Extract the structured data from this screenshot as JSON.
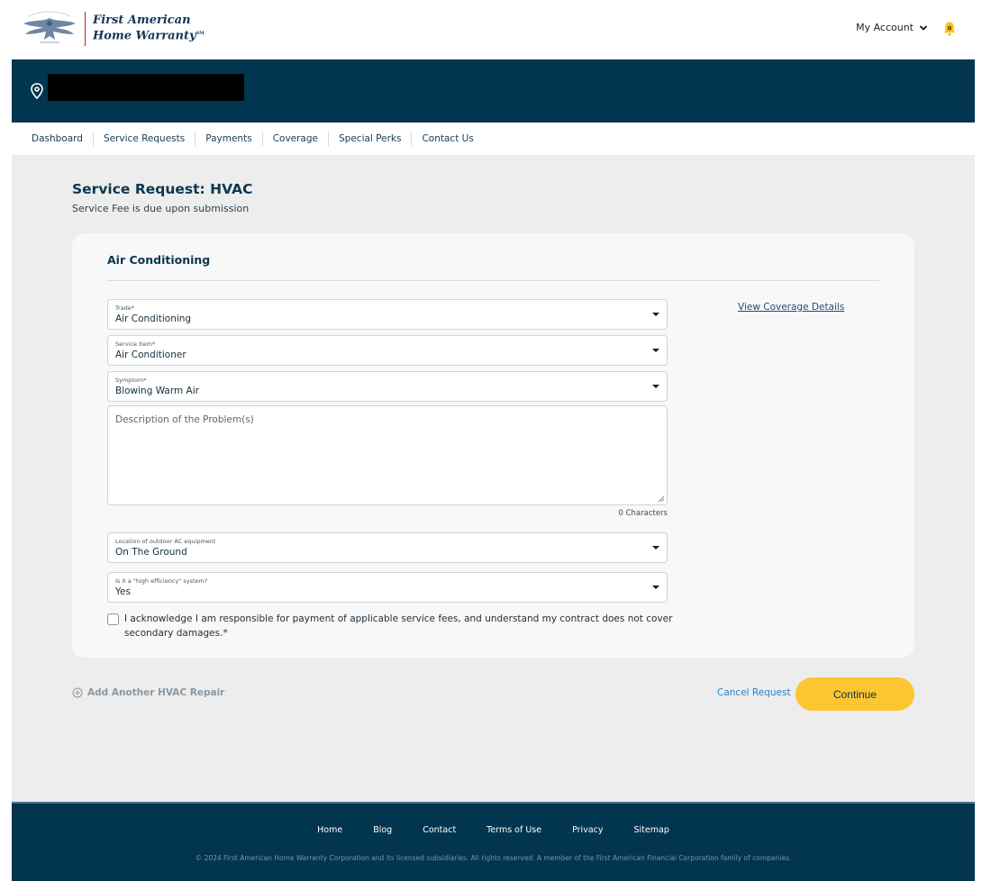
{
  "header": {
    "brand_line1": "First American",
    "brand_line2": "Home Warranty",
    "brand_mark": "SM",
    "account_label": "My Account",
    "notification_count": "0"
  },
  "nav": {
    "items": [
      "Dashboard",
      "Service Requests",
      "Payments",
      "Coverage",
      "Special Perks",
      "Contact Us"
    ]
  },
  "page": {
    "title": "Service Request: HVAC",
    "subtitle": "Service Fee is due upon submission"
  },
  "card": {
    "title": "Air Conditioning",
    "coverage_link": "View Coverage Details",
    "fields": {
      "trade": {
        "label": "Trade*",
        "value": "Air Conditioning"
      },
      "service_item": {
        "label": "Service Item*",
        "value": "Air Conditioner"
      },
      "symptom": {
        "label": "Symptom*",
        "value": "Blowing Warm Air"
      },
      "location": {
        "label": "Location of outdoor AC equipment",
        "value": "On The Ground"
      },
      "efficiency": {
        "label": "Is it a \"high efficiency\" system?",
        "value": "Yes"
      }
    },
    "description_placeholder": "Description of the Problem(s)",
    "char_count": "0 Characters",
    "acknowledgement": "I acknowledge I am responsible for payment of applicable service fees, and understand my contract does not cover secondary damages.*"
  },
  "actions": {
    "add_repair": "Add Another HVAC Repair",
    "cancel": "Cancel Request",
    "continue": "Continue"
  },
  "footer": {
    "links": [
      "Home",
      "Blog",
      "Contact",
      "Terms of Use",
      "Privacy",
      "Sitemap"
    ],
    "copyright": "© 2024 First American Home Warranty Corporation and its licensed subsidiaries. All rights reserved. A member of the First American Financial Corporation family of companies."
  },
  "colors": {
    "brand_navy": "#02354f",
    "accent_yellow": "#fdc530",
    "link_blue": "#2d82c6",
    "logo_red": "#c8202f"
  }
}
